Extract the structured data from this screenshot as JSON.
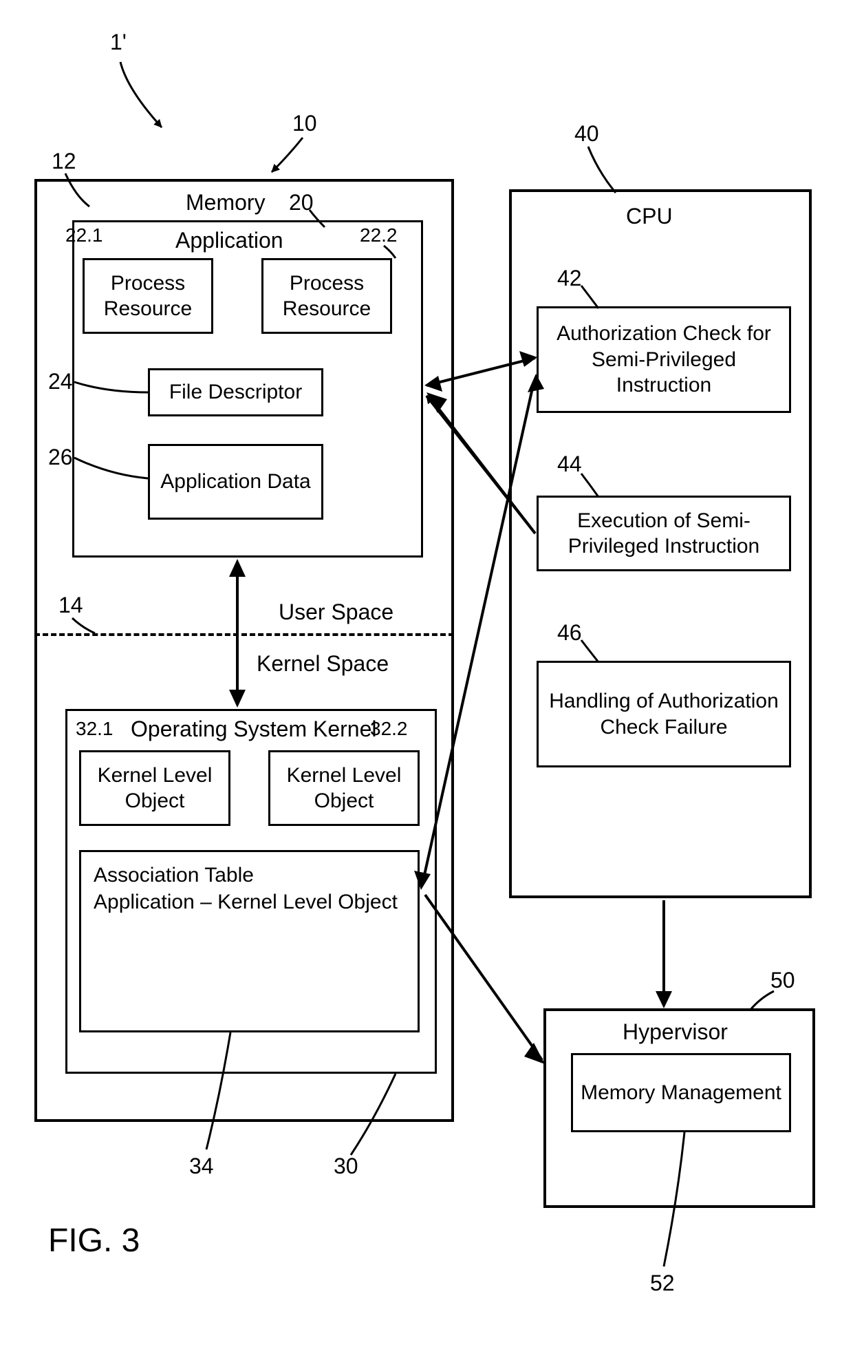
{
  "figure_label": "FIG. 3",
  "ref_1prime": "1'",
  "ref_10": "10",
  "ref_12": "12",
  "ref_14": "14",
  "ref_20": "20",
  "ref_22_1": "22.1",
  "ref_22_2": "22.2",
  "ref_24": "24",
  "ref_26": "26",
  "ref_30": "30",
  "ref_32_1": "32.1",
  "ref_32_2": "32.2",
  "ref_34": "34",
  "ref_40": "40",
  "ref_42": "42",
  "ref_44": "44",
  "ref_46": "46",
  "ref_50": "50",
  "ref_52": "52",
  "memory_title": "Memory",
  "application_title": "Application",
  "process_resource": "Process Resource",
  "file_descriptor": "File Descriptor",
  "application_data": "Application Data",
  "user_space": "User Space",
  "kernel_space": "Kernel Space",
  "os_kernel_title": "Operating System Kernel",
  "kernel_level_object": "Kernel Level Object",
  "assoc_table_line1": "Association Table",
  "assoc_table_line2": "Application – Kernel Level Object",
  "cpu_title": "CPU",
  "cpu_42": "Authorization Check for Semi-Privileged Instruction",
  "cpu_44": "Execution of Semi-Privileged Instruction",
  "cpu_46": "Handling of Authorization Check Failure",
  "hypervisor_title": "Hypervisor",
  "hypervisor_52": "Memory Management"
}
